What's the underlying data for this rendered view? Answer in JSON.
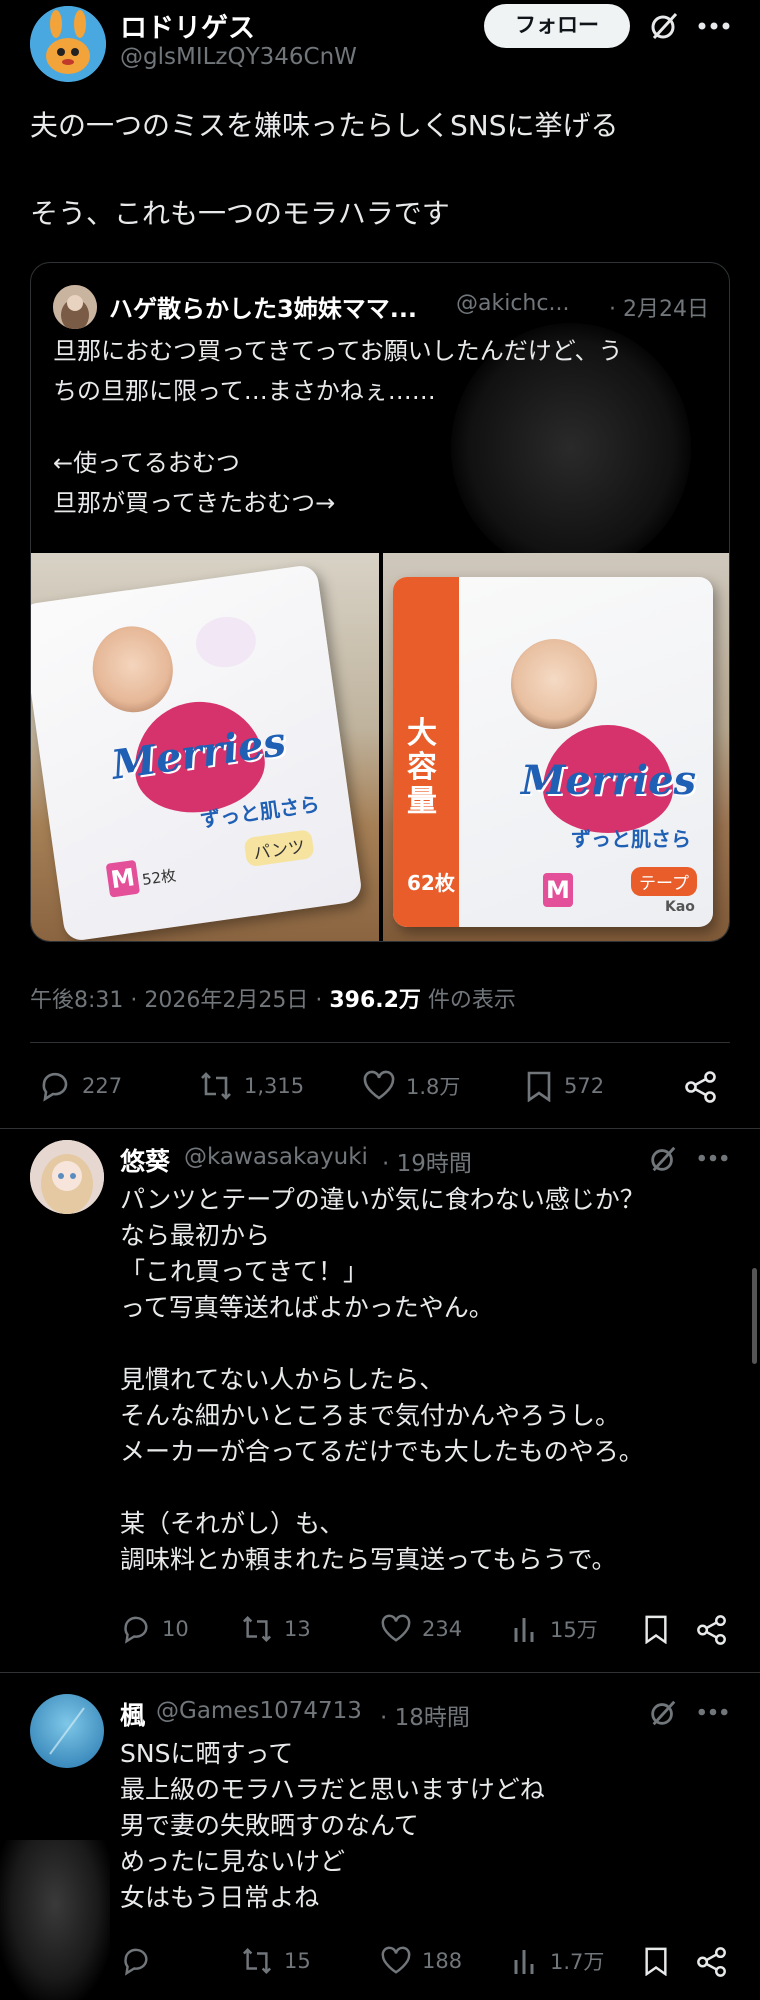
{
  "post": {
    "author_name": "ロドリゲス",
    "author_handle": "@glsMILzQY346CnW",
    "follow_label": "フォロー",
    "text_line1": "夫の一つのミスを嫌味ったらしくSNSに挙げる",
    "text_line2": "そう、これも一つのモラハラです",
    "timestamp": "午後8:31 · 2026年2月25日 · ",
    "views_count": "396.2万",
    "views_label": " 件の表示",
    "stats": {
      "replies": "227",
      "reposts": "1,315",
      "likes": "1.8万",
      "bookmarks": "572"
    }
  },
  "quote": {
    "author_name": "ハゲ散らかした3姉妹ママ...",
    "author_handle": "@akichc...",
    "date": "· 2月24日",
    "line1": "旦那におむつ買ってきてってお願いしたんだけど、う",
    "line2": "ちの旦那に限って…まさかねぇ……",
    "line3": "←使ってるおむつ",
    "line4": "旦那が買ってきたおむつ→",
    "image_left": {
      "brand": "Merries",
      "tagline": "ずっと肌さら",
      "size": "M",
      "count": "52枚",
      "type": "パンツ"
    },
    "image_right": {
      "brand": "Merries",
      "tagline": "ずっと肌さら",
      "size": "M",
      "count": "62枚",
      "band": "大容量",
      "type": "テープ",
      "maker": "Kao"
    }
  },
  "replies": [
    {
      "author_name": "悠葵",
      "author_handle": "@kawasakayuki",
      "time": "· 19時間",
      "lines": [
        "パンツとテープの違いが気に食わない感じか？",
        "なら最初から",
        "「これ買ってきて！」",
        "って写真等送ればよかったやん。",
        "",
        "見慣れてない人からしたら、",
        "そんな細かいところまで気付かんやろうし。",
        "メーカーが合ってるだけでも大したものやろ。",
        "",
        "某（それがし）も、",
        "調味料とか頼まれたら写真送ってもらうで。"
      ],
      "stats": {
        "replies": "10",
        "reposts": "13",
        "likes": "234",
        "views": "15万"
      }
    },
    {
      "author_name": "楓",
      "author_handle": "@Games1074713",
      "time": "· 18時間",
      "lines": [
        "SNSに晒すって",
        "最上級のモラハラだと思いますけどね",
        "男で妻の失敗晒すのなんて",
        "めったに見ないけど",
        "女はもう日常よね"
      ],
      "stats": {
        "replies": "",
        "reposts": "15",
        "likes": "188",
        "views": "1.7万"
      }
    }
  ],
  "colors": {
    "background": "#000000",
    "text": "#e7e9ea",
    "muted": "#71767b",
    "divider": "#2f3336",
    "merries_pink": "#d6336c",
    "band_orange": "#e85d2a"
  }
}
